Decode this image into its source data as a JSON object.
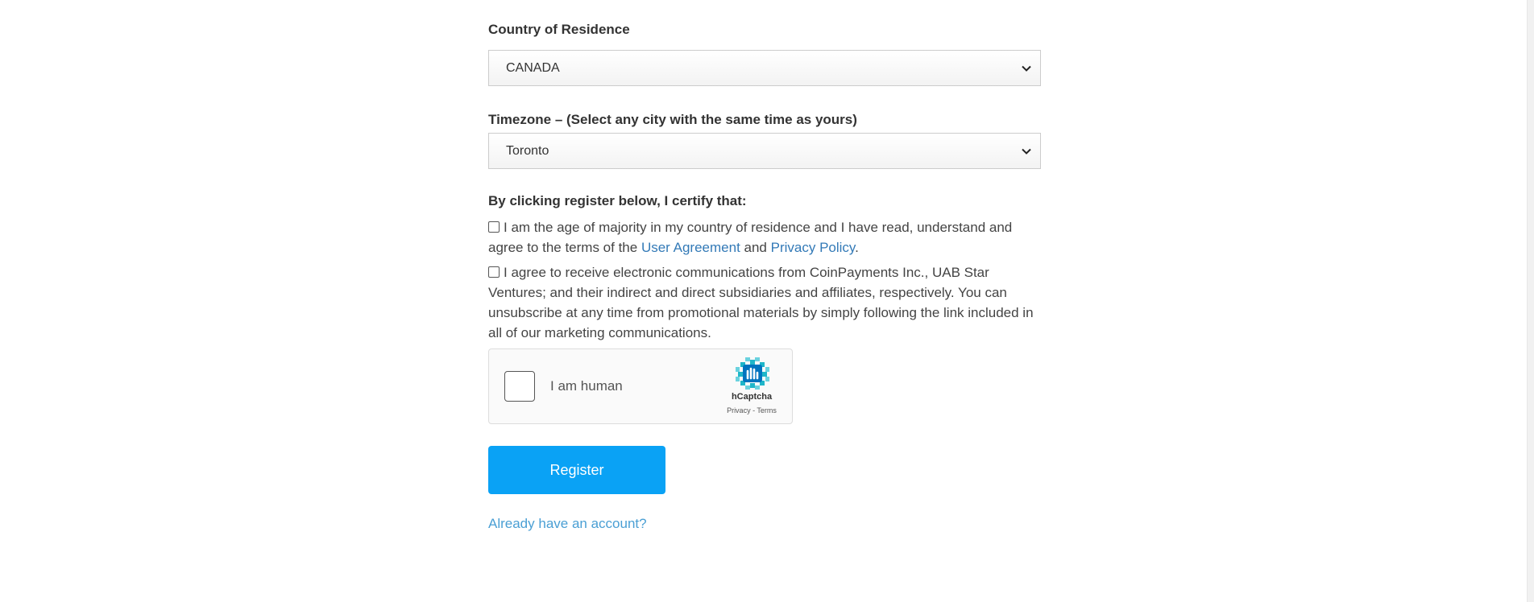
{
  "country": {
    "label": "Country of Residence",
    "selected": "CANADA"
  },
  "timezone": {
    "label": "Timezone – (Select any city with the same time as yours)",
    "selected": "Toronto"
  },
  "certify": {
    "heading": "By clicking register below, I certify that:",
    "agreement": {
      "text_before": "I am the age of majority in my country of residence and I have read, understand and agree to the terms of the ",
      "user_agreement_link": "User Agreement",
      "text_and": " and ",
      "privacy_policy_link": "Privacy Policy",
      "text_after": "."
    },
    "communications": {
      "text": "I agree to receive electronic communications from CoinPayments Inc., UAB Star Ventures; and their indirect and direct subsidiaries and affiliates, respectively. You can unsubscribe at any time from promotional materials by simply following the link included in all of our marketing communications."
    }
  },
  "captcha": {
    "label": "I am human",
    "brand": "hCaptcha",
    "privacy": "Privacy",
    "separator": " - ",
    "terms": "Terms"
  },
  "register_button": "Register",
  "signin_link": "Already have an account?",
  "colors": {
    "primary_button": "#0aa2f5",
    "link": "#337ab7",
    "captcha_logo": "#1fb6c9"
  },
  "icons": {
    "select_chevron": "chevron-down-icon",
    "captcha_logo": "hcaptcha-logo-icon"
  }
}
